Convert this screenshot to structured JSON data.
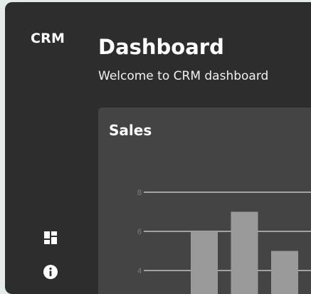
{
  "sidebar": {
    "brand": "CRM",
    "items": [
      {
        "name": "dashboard",
        "icon": "dashboard-icon"
      },
      {
        "name": "info",
        "icon": "info-icon"
      }
    ]
  },
  "header": {
    "title": "Dashboard",
    "subtitle": "Welcome to CRM dashboard"
  },
  "sales_card": {
    "title": "Sales"
  },
  "colors": {
    "app_bg": "#2d2d2d",
    "card_bg": "#444444",
    "bar": "#9a9a9a",
    "grid": "#ffffff",
    "tick": "#7e7e7e"
  },
  "chart_data": {
    "type": "bar",
    "title": "Sales",
    "categories": [
      "",
      "",
      ""
    ],
    "values": [
      6,
      7,
      5
    ],
    "y_ticks": [
      4,
      6,
      8
    ],
    "ylim": [
      0,
      9
    ],
    "grid": true
  }
}
